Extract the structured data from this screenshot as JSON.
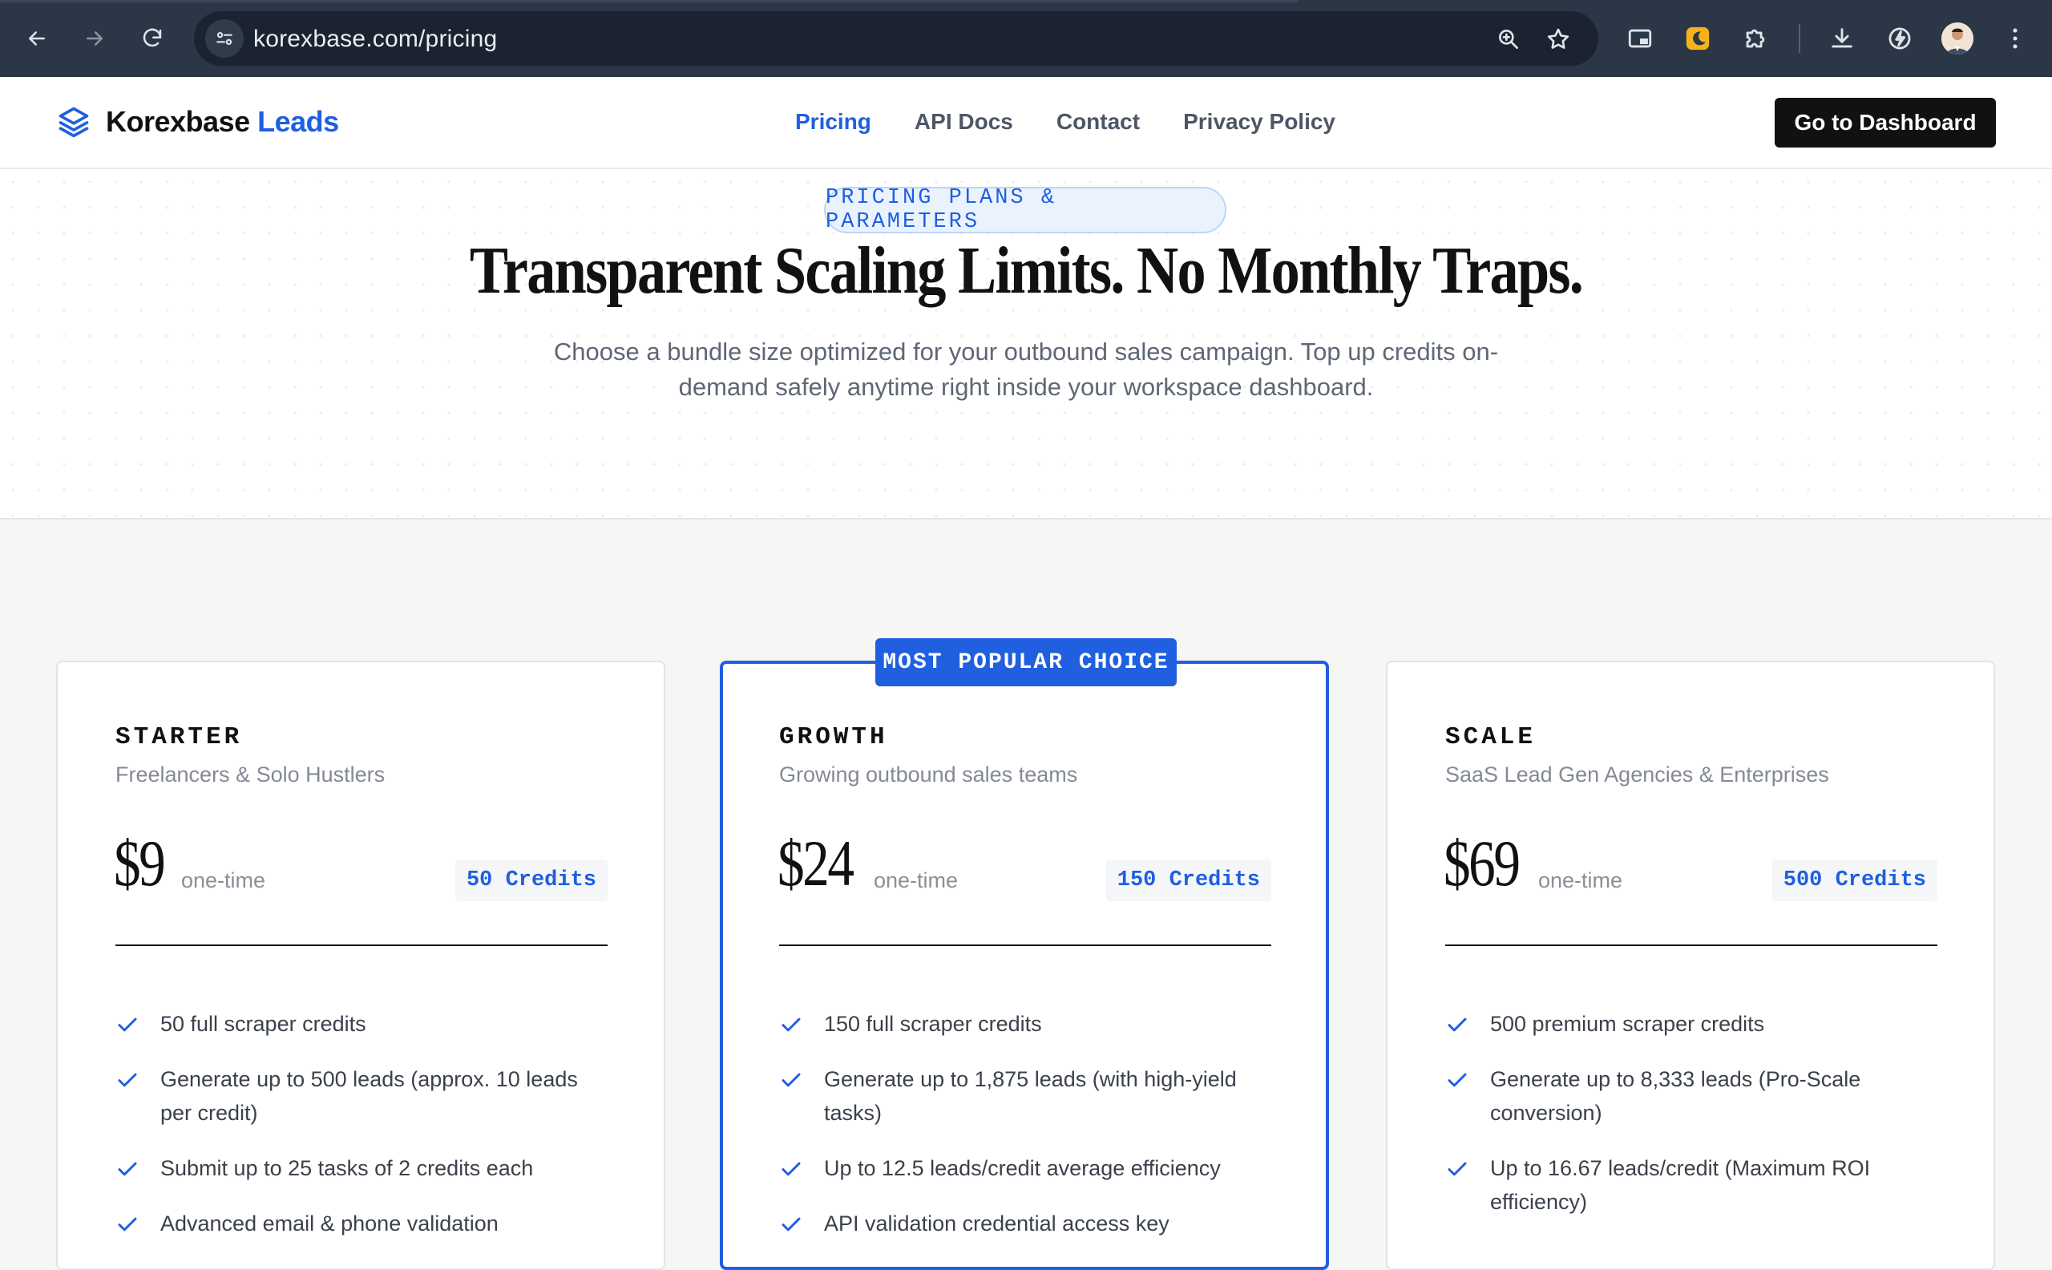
{
  "browser": {
    "url": "korexbase.com/pricing",
    "icons": [
      "back-icon",
      "forward-icon",
      "reload-icon",
      "site-info-icon",
      "zoom-icon",
      "star-icon",
      "picture-in-picture-icon",
      "extension-moon-icon",
      "puzzle-icon",
      "download-icon",
      "performance-icon",
      "profile-avatar",
      "more-menu-icon"
    ]
  },
  "header": {
    "brand": "Korexbase",
    "brand_accent": "Leads",
    "nav": [
      {
        "label": "Pricing",
        "active": true
      },
      {
        "label": "API Docs",
        "active": false
      },
      {
        "label": "Contact",
        "active": false
      },
      {
        "label": "Privacy Policy",
        "active": false
      }
    ],
    "cta": "Go to Dashboard"
  },
  "hero": {
    "badge": "PRICING PLANS & PARAMETERS",
    "title": "Transparent Scaling Limits. No Monthly Traps.",
    "subtitle": "Choose a bundle size optimized for your outbound sales campaign. Top up credits on-demand safely anytime right inside your workspace dashboard."
  },
  "popular_tag": "MOST POPULAR CHOICE",
  "plans": [
    {
      "name": "STARTER",
      "audience": "Freelancers & Solo Hustlers",
      "price": "$9",
      "price_note": "one-time",
      "credits": "50 Credits",
      "features": [
        "50 full scraper credits",
        "Generate up to 500 leads (approx. 10 leads per credit)",
        "Submit up to 25 tasks of 2 credits each",
        "Advanced email & phone validation"
      ]
    },
    {
      "name": "GROWTH",
      "audience": "Growing outbound sales teams",
      "price": "$24",
      "price_note": "one-time",
      "credits": "150 Credits",
      "features": [
        "150 full scraper credits",
        "Generate up to 1,875 leads (with high-yield tasks)",
        "Up to 12.5 leads/credit average efficiency",
        "API validation credential access key"
      ]
    },
    {
      "name": "SCALE",
      "audience": "SaaS Lead Gen Agencies & Enterprises",
      "price": "$69",
      "price_note": "one-time",
      "credits": "500 Credits",
      "features": [
        "500 premium scraper credits",
        "Generate up to 8,333 leads (Pro-Scale conversion)",
        "Up to 16.67 leads/credit (Maximum ROI efficiency)"
      ]
    }
  ],
  "colors": {
    "accent": "#1f5fe0",
    "chrome": "#2b3646",
    "dark_button": "#111111"
  }
}
